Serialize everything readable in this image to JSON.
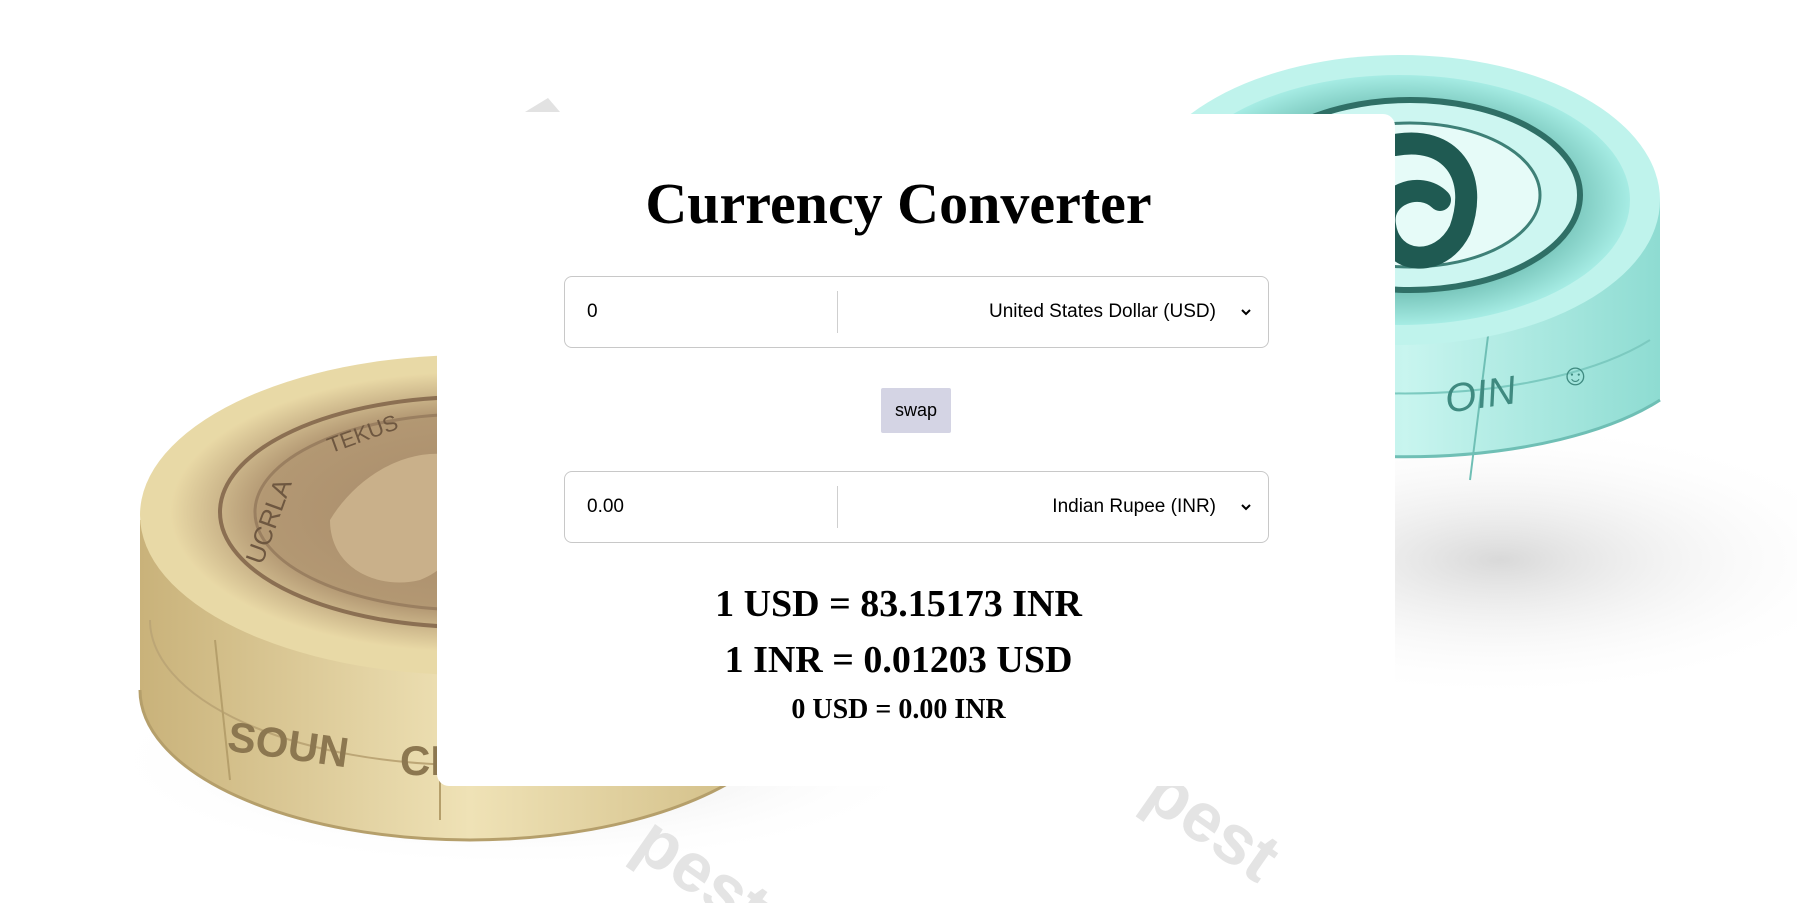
{
  "page": {
    "title": "Currency Converter"
  },
  "converter": {
    "from": {
      "amount": "0",
      "currency": "United States Dollar (USD)"
    },
    "swap_label": "swap",
    "to": {
      "amount": "0.00",
      "currency": "Indian Rupee (INR)"
    }
  },
  "rates": {
    "forward": "1 USD = 83.15173 INR",
    "reverse": "1 INR = 0.01203 USD",
    "result": "0 USD = 0.00 INR"
  },
  "colors": {
    "swap_button": "#d4d4e4",
    "card": "#ffffff",
    "gold_coin": "#d8c48e",
    "teal_coin": "#9fe6de"
  },
  "icons": {
    "select_chevron": "chevron-down-icon"
  }
}
